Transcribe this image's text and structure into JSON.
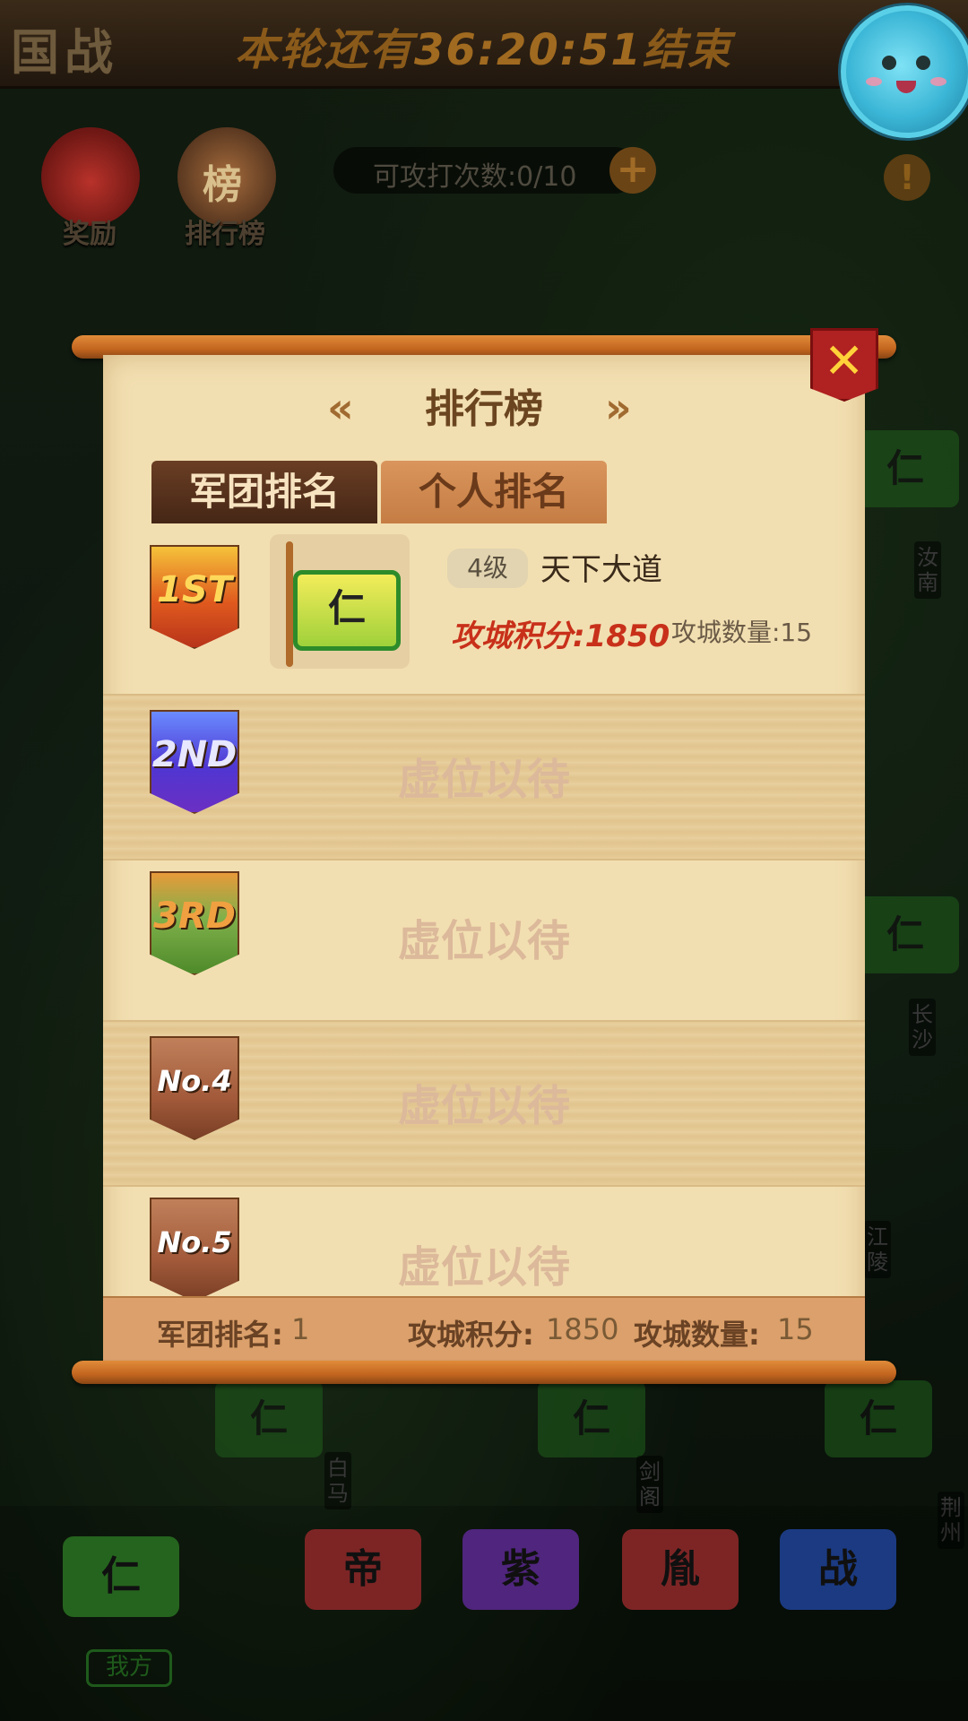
{
  "header": {
    "nation_label": "国战",
    "countdown_prefix": "本轮还有",
    "countdown_time": "36:20:51",
    "countdown_suffix": "结束"
  },
  "top_icons": {
    "reward_label": "奖励",
    "ranking_label": "排行榜",
    "ranking_glyph": "榜"
  },
  "attack_counter": {
    "text": "可攻打次数:0/10",
    "plus": "+",
    "info": "!"
  },
  "map": {
    "flags": [
      {
        "char": "仁"
      },
      {
        "char": "仁"
      },
      {
        "char": "仁"
      },
      {
        "char": "仁"
      },
      {
        "char": "仁"
      }
    ],
    "cities": [
      "汝南",
      "长沙",
      "江陵",
      "白马",
      "剑阁",
      "荆州"
    ],
    "bottom_flags": [
      "仁",
      "帝",
      "紫",
      "胤",
      "战"
    ],
    "mine_tag": "我方"
  },
  "panel": {
    "title": "排行榜",
    "arrow_left": "«",
    "arrow_right": "»",
    "close": "✕",
    "tabs": [
      {
        "label": "军团排名",
        "active": true
      },
      {
        "label": "个人排名",
        "active": false
      }
    ],
    "rows": [
      {
        "medal": "1ST",
        "level": "4级",
        "name": "天下大道",
        "emblem_char": "仁",
        "score_text": "攻城积分:1850",
        "count_text": "攻城数量:15"
      },
      {
        "medal": "2ND",
        "placeholder": "虚位以待"
      },
      {
        "medal": "3RD",
        "placeholder": "虚位以待"
      },
      {
        "medal": "No.4",
        "placeholder": "虚位以待"
      },
      {
        "medal": "No.5",
        "placeholder": "虚位以待"
      }
    ],
    "footer": {
      "rank_label": "军团排名:",
      "rank_value": "1",
      "score_label": "攻城积分:",
      "score_value": "1850",
      "count_label": "攻城数量:",
      "count_value": "15"
    }
  },
  "colors": {
    "paper": "#f2dfb1",
    "rod": "#d9772c",
    "close_bg": "#b02121",
    "score_red": "#c8301a"
  }
}
